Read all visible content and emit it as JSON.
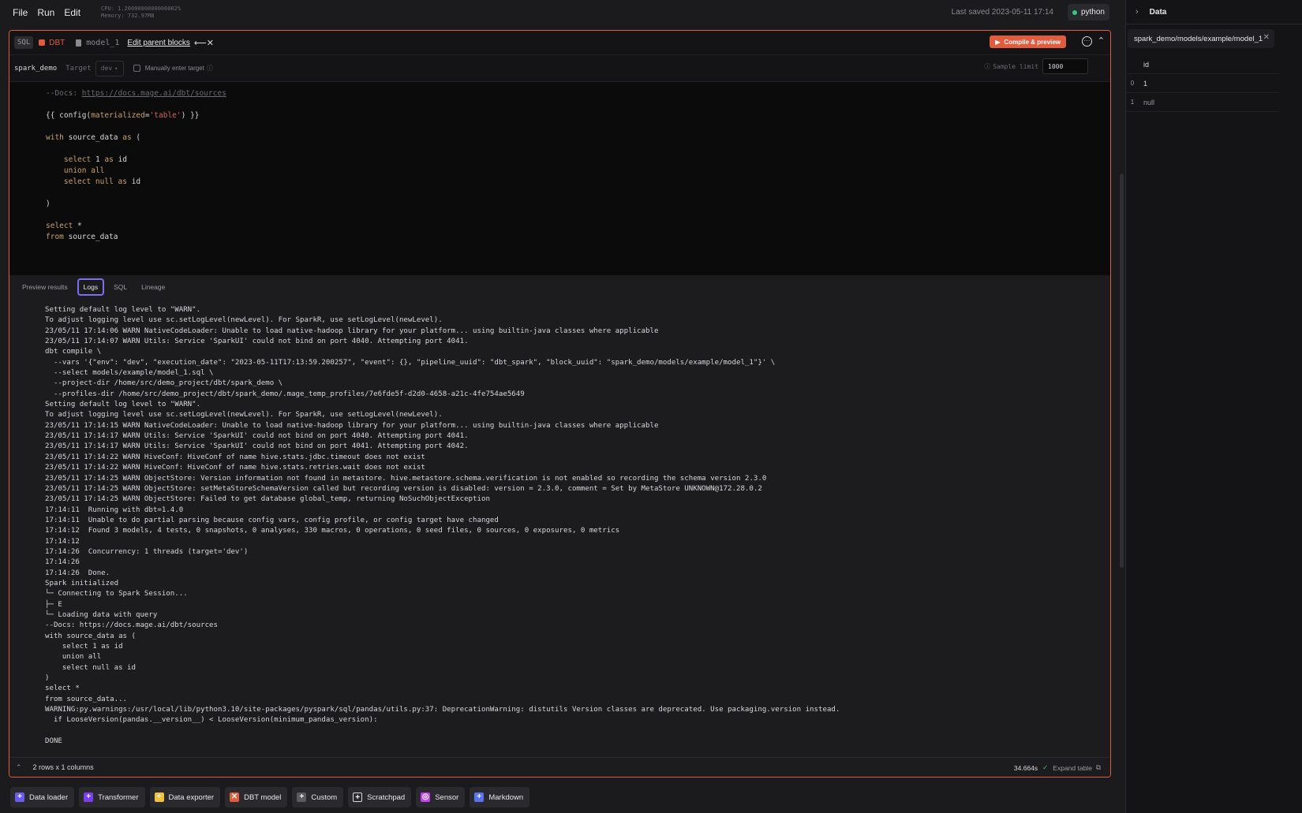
{
  "menu": [
    "File",
    "Run",
    "Edit"
  ],
  "sysinfo": {
    "cpu": "CPU: 1.2000000000000002%",
    "memory": "Memory: 732.97MB"
  },
  "last_saved": "Last saved 2023-05-11 17:14",
  "kernel": "python",
  "block": {
    "lang": "SQL",
    "type": "DBT",
    "name": "model_1",
    "edit_parents": "Edit parent blocks",
    "compile_label": "Compile & preview",
    "project": "spark_demo",
    "target_label": "Target",
    "target_value": "dev",
    "manual_target": "Manually enter target",
    "sample_label": "Sample limit",
    "sample_value": "1000"
  },
  "code_lines": [
    "--Docs: https://docs.mage.ai/dbt/sources",
    "",
    "{{ config(materialized='table') }}",
    "",
    "with source_data as (",
    "",
    "    select 1 as id",
    "    union all",
    "    select null as id",
    "",
    ")",
    "",
    "select *",
    "from source_data"
  ],
  "output_tabs": [
    "Preview results",
    "Logs",
    "SQL",
    "Lineage"
  ],
  "active_tab": "Logs",
  "log_lines": [
    "Setting default log level to \"WARN\".",
    "To adjust logging level use sc.setLogLevel(newLevel). For SparkR, use setLogLevel(newLevel).",
    "23/05/11 17:14:06 WARN NativeCodeLoader: Unable to load native-hadoop library for your platform... using builtin-java classes where applicable",
    "23/05/11 17:14:07 WARN Utils: Service 'SparkUI' could not bind on port 4040. Attempting port 4041.",
    "dbt compile \\",
    "  --vars '{\"env\": \"dev\", \"execution_date\": \"2023-05-11T17:13:59.200257\", \"event\": {}, \"pipeline_uuid\": \"dbt_spark\", \"block_uuid\": \"spark_demo/models/example/model_1\"}' \\",
    "  --select models/example/model_1.sql \\",
    "  --project-dir /home/src/demo_project/dbt/spark_demo \\",
    "  --profiles-dir /home/src/demo_project/dbt/spark_demo/.mage_temp_profiles/7e6fde5f-d2d0-4658-a21c-4fe754ae5649",
    "Setting default log level to \"WARN\".",
    "To adjust logging level use sc.setLogLevel(newLevel). For SparkR, use setLogLevel(newLevel).",
    "23/05/11 17:14:15 WARN NativeCodeLoader: Unable to load native-hadoop library for your platform... using builtin-java classes where applicable",
    "23/05/11 17:14:17 WARN Utils: Service 'SparkUI' could not bind on port 4040. Attempting port 4041.",
    "23/05/11 17:14:17 WARN Utils: Service 'SparkUI' could not bind on port 4041. Attempting port 4042.",
    "23/05/11 17:14:22 WARN HiveConf: HiveConf of name hive.stats.jdbc.timeout does not exist",
    "23/05/11 17:14:22 WARN HiveConf: HiveConf of name hive.stats.retries.wait does not exist",
    "23/05/11 17:14:25 WARN ObjectStore: Version information not found in metastore. hive.metastore.schema.verification is not enabled so recording the schema version 2.3.0",
    "23/05/11 17:14:25 WARN ObjectStore: setMetaStoreSchemaVersion called but recording version is disabled: version = 2.3.0, comment = Set by MetaStore UNKNOWN@172.28.0.2",
    "23/05/11 17:14:25 WARN ObjectStore: Failed to get database global_temp, returning NoSuchObjectException",
    "17:14:11  Running with dbt=1.4.0",
    "17:14:11  Unable to do partial parsing because config vars, config profile, or config target have changed",
    "17:14:12  Found 3 models, 4 tests, 0 snapshots, 0 analyses, 330 macros, 0 operations, 0 seed files, 0 sources, 0 exposures, 0 metrics",
    "17:14:12",
    "17:14:26  Concurrency: 1 threads (target='dev')",
    "17:14:26",
    "17:14:26  Done.",
    "Spark initialized",
    "└─ Connecting to Spark Session...",
    "├─ E",
    "└─ Loading data with query",
    "--Docs: https://docs.mage.ai/dbt/sources",
    "with source_data as (",
    "    select 1 as id",
    "    union all",
    "    select null as id",
    ")",
    "select *",
    "from source_data...",
    "WARNING:py.warnings:/usr/local/lib/python3.10/site-packages/pyspark/sql/pandas/utils.py:37: DeprecationWarning: distutils Version classes are deprecated. Use packaging.version instead.",
    "  if LooseVersion(pandas.__version__) < LooseVersion(minimum_pandas_version):",
    "",
    "DONE"
  ],
  "footer": {
    "rows": "2 rows x 1 columns",
    "time": "34.664s",
    "expand": "Expand table"
  },
  "add_blocks": [
    {
      "label": "Data loader",
      "color": "#6b5cf0",
      "glyph": "+"
    },
    {
      "label": "Transformer",
      "color": "#7b3ff0",
      "glyph": "+"
    },
    {
      "label": "Data exporter",
      "color": "#f0c03f",
      "glyph": "+"
    },
    {
      "label": "DBT model",
      "color": "#e15b3c",
      "glyph": "✕"
    },
    {
      "label": "Custom",
      "color": "#5a5a60",
      "glyph": "+"
    },
    {
      "label": "Scratchpad",
      "color": "#2a2a2e",
      "glyph": "+"
    },
    {
      "label": "Sensor",
      "color": "#c23ff0",
      "glyph": "◎"
    },
    {
      "label": "Markdown",
      "color": "#5a74f0",
      "glyph": "+"
    }
  ],
  "right_panel": {
    "title": "Data",
    "tab": "spark_demo/models/example/model_1",
    "column": "id",
    "rows": [
      {
        "index": "0",
        "value": "1"
      },
      {
        "index": "1",
        "value": "null"
      }
    ]
  }
}
